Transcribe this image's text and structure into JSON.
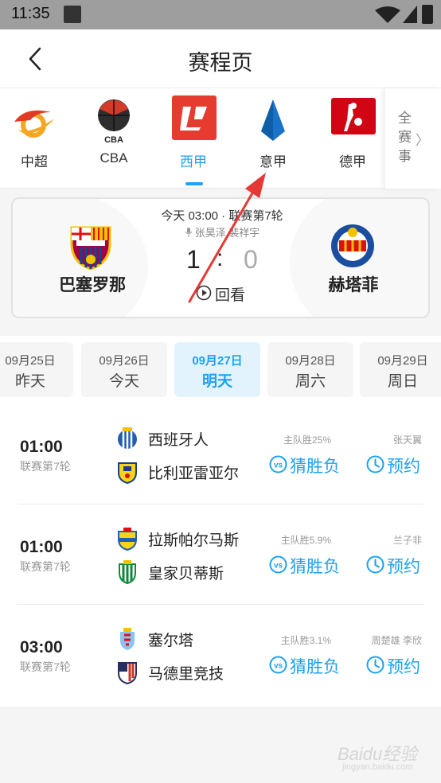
{
  "status_bar": {
    "time": "11:35"
  },
  "header": {
    "title": "赛程页"
  },
  "leagues": {
    "items": [
      {
        "label": "中超",
        "icon": "csl-logo-icon",
        "active": false
      },
      {
        "label": "CBA",
        "icon": "cba-logo-icon",
        "active": false
      },
      {
        "label": "西甲",
        "icon": "laliga-logo-icon",
        "active": true
      },
      {
        "label": "意甲",
        "icon": "serie-a-logo-icon",
        "active": false
      },
      {
        "label": "德甲",
        "icon": "bundesliga-logo-icon",
        "active": false
      }
    ],
    "all_label": "全赛事",
    "all_chars": [
      "全",
      "赛",
      "事"
    ],
    "all_chevron": "〉"
  },
  "featured_match": {
    "time_round": "今天 03:00 · 联赛第7轮",
    "commentators": "张昊泽 裴祥宇",
    "home_team": "巴塞罗那",
    "away_team": "赫塔菲",
    "home_score": "1",
    "separator": ":",
    "away_score": "0",
    "replay_label": "回看"
  },
  "dates": [
    {
      "date": "09月25日",
      "weekday": "昨天",
      "active": false
    },
    {
      "date": "09月26日",
      "weekday": "今天",
      "active": false
    },
    {
      "date": "09月27日",
      "weekday": "明天",
      "active": true
    },
    {
      "date": "09月28日",
      "weekday": "周六",
      "active": false
    },
    {
      "date": "09月29日",
      "weekday": "周日",
      "active": false
    }
  ],
  "matches": [
    {
      "time": "01:00",
      "round": "联赛第7轮",
      "home": "西班牙人",
      "away": "比利亚雷亚尔",
      "odds": "主队胜25%",
      "guess_label": "猜胜负",
      "commentators": "张天翼",
      "reserve_label": "预约"
    },
    {
      "time": "01:00",
      "round": "联赛第7轮",
      "home": "拉斯帕尔马斯",
      "away": "皇家贝蒂斯",
      "odds": "主队胜5.9%",
      "guess_label": "猜胜负",
      "commentators": "兰子非",
      "reserve_label": "预约"
    },
    {
      "time": "03:00",
      "round": "联赛第7轮",
      "home": "塞尔塔",
      "away": "马德里竞技",
      "odds": "主队胜3.1%",
      "guess_label": "猜胜负",
      "commentators": "周楚雄 李欣",
      "reserve_label": "预约"
    }
  ],
  "watermark": {
    "text": "Baidu经验",
    "url": "jingyan.baidu.com"
  },
  "colors": {
    "accent": "#1ea1f2",
    "arrow": "#e53935",
    "laliga": "#e63c2f",
    "serie_a": "#1a73c9",
    "bundesliga": "#d20515"
  }
}
